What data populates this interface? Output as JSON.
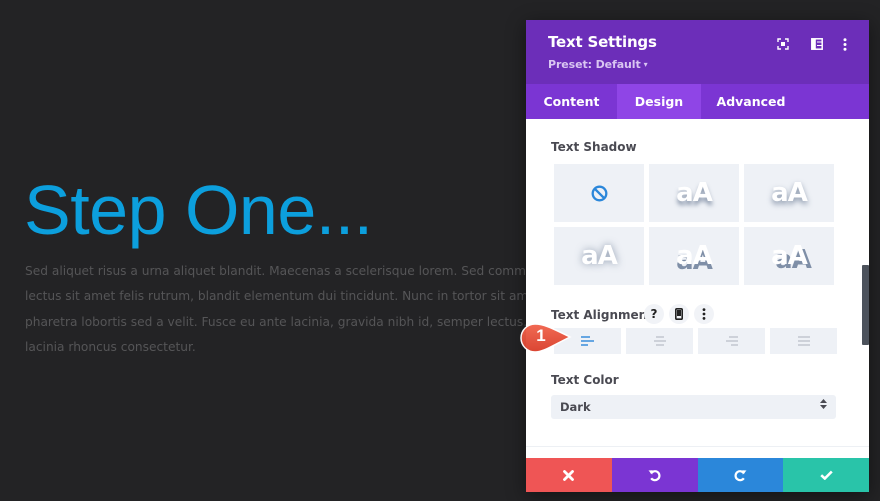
{
  "page": {
    "heading": "Step One...",
    "body_lines": [
      "Sed aliquet risus a urna aliquet blandit. Maecenas a scelerisque lorem. Sed commodo",
      "lectus sit amet felis rutrum, blandit elementum dui tincidunt. Nunc in tortor sit amet leo",
      "pharetra lobortis sed a velit. Fusce eu ante lacinia, gravida nibh id, semper lectus. Quisque",
      "lacinia rhoncus consectetur."
    ],
    "heading_color": "#0c9fdd"
  },
  "panel": {
    "title": "Text Settings",
    "preset_label": "Preset: Default",
    "preset_caret": "▾",
    "header_icons": [
      "focus-icon",
      "sidebar-layout-icon",
      "more-vertical-icon"
    ],
    "tabs": [
      {
        "label": "Content",
        "active": false
      },
      {
        "label": "Design",
        "active": true
      },
      {
        "label": "Advanced",
        "active": false
      }
    ],
    "text_shadow": {
      "label": "Text Shadow",
      "options": [
        {
          "name": "none",
          "preview": ""
        },
        {
          "name": "shadow-1",
          "preview": "aA"
        },
        {
          "name": "shadow-2",
          "preview": "aA"
        },
        {
          "name": "shadow-3",
          "preview": "aA"
        },
        {
          "name": "shadow-4",
          "preview": "aA"
        },
        {
          "name": "shadow-5",
          "preview": "aA"
        }
      ]
    },
    "text_alignment": {
      "label": "Text Alignment",
      "help_label": "?",
      "options": [
        "left",
        "center",
        "right",
        "justify"
      ],
      "selected": "left"
    },
    "text_color": {
      "label": "Text Color",
      "value": "Dark",
      "updown": "▲▼"
    },
    "footer": {
      "cancel": "✖",
      "undo": "↺",
      "redo": "↻",
      "save": "✔"
    },
    "colors": {
      "header": "#6c2eb9",
      "tabs": "#7b35d3",
      "tab_active": "#8f45e6",
      "cancel": "#ef5555",
      "undo": "#7b35d3",
      "redo": "#2b87da",
      "save": "#29c4a9",
      "accent": "#2b87da"
    }
  },
  "annotation": {
    "marker_label": "1"
  }
}
